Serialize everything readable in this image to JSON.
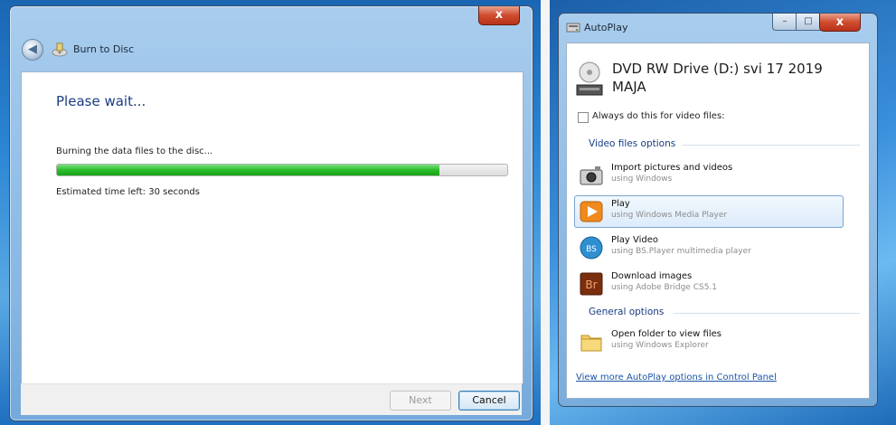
{
  "burn_window": {
    "title": "Burn to Disc",
    "close_label": "x",
    "back_label": "◀",
    "heading": "Please wait...",
    "status": "Burning the data files to the disc...",
    "progress": 0.85,
    "eta": "Estimated time left: 30 seconds",
    "next_label": "Next",
    "cancel_label": "Cancel"
  },
  "autoplay_window": {
    "title": "AutoPlay",
    "minimize_label": "–",
    "maximize_label": "□",
    "close_label": "x",
    "drive_title": "DVD RW Drive (D:) svi 17 2019 MAJA",
    "always_label": "Always do this for video files:",
    "video_section": "Video files options",
    "options": [
      {
        "main": "Import pictures and videos",
        "sub": "using Windows",
        "icon": "camera-icon"
      },
      {
        "main": "Play",
        "sub": "using Windows Media Player",
        "icon": "media-player-icon"
      },
      {
        "main": "Play Video",
        "sub": "using BS.Player multimedia player",
        "icon": "bs-player-icon"
      },
      {
        "main": "Download images",
        "sub": "using Adobe Bridge CS5.1",
        "icon": "adobe-bridge-icon"
      }
    ],
    "general_section": "General options",
    "general_option": {
      "main": "Open folder to view files",
      "sub": "using Windows Explorer",
      "icon": "folder-icon"
    },
    "link": "View more AutoPlay options in Control Panel"
  },
  "colors": {
    "progress_green": "#2bbd2b",
    "close_red": "#cf4c2e",
    "link_blue": "#1a55a6",
    "heading_blue": "#1a3c82"
  }
}
